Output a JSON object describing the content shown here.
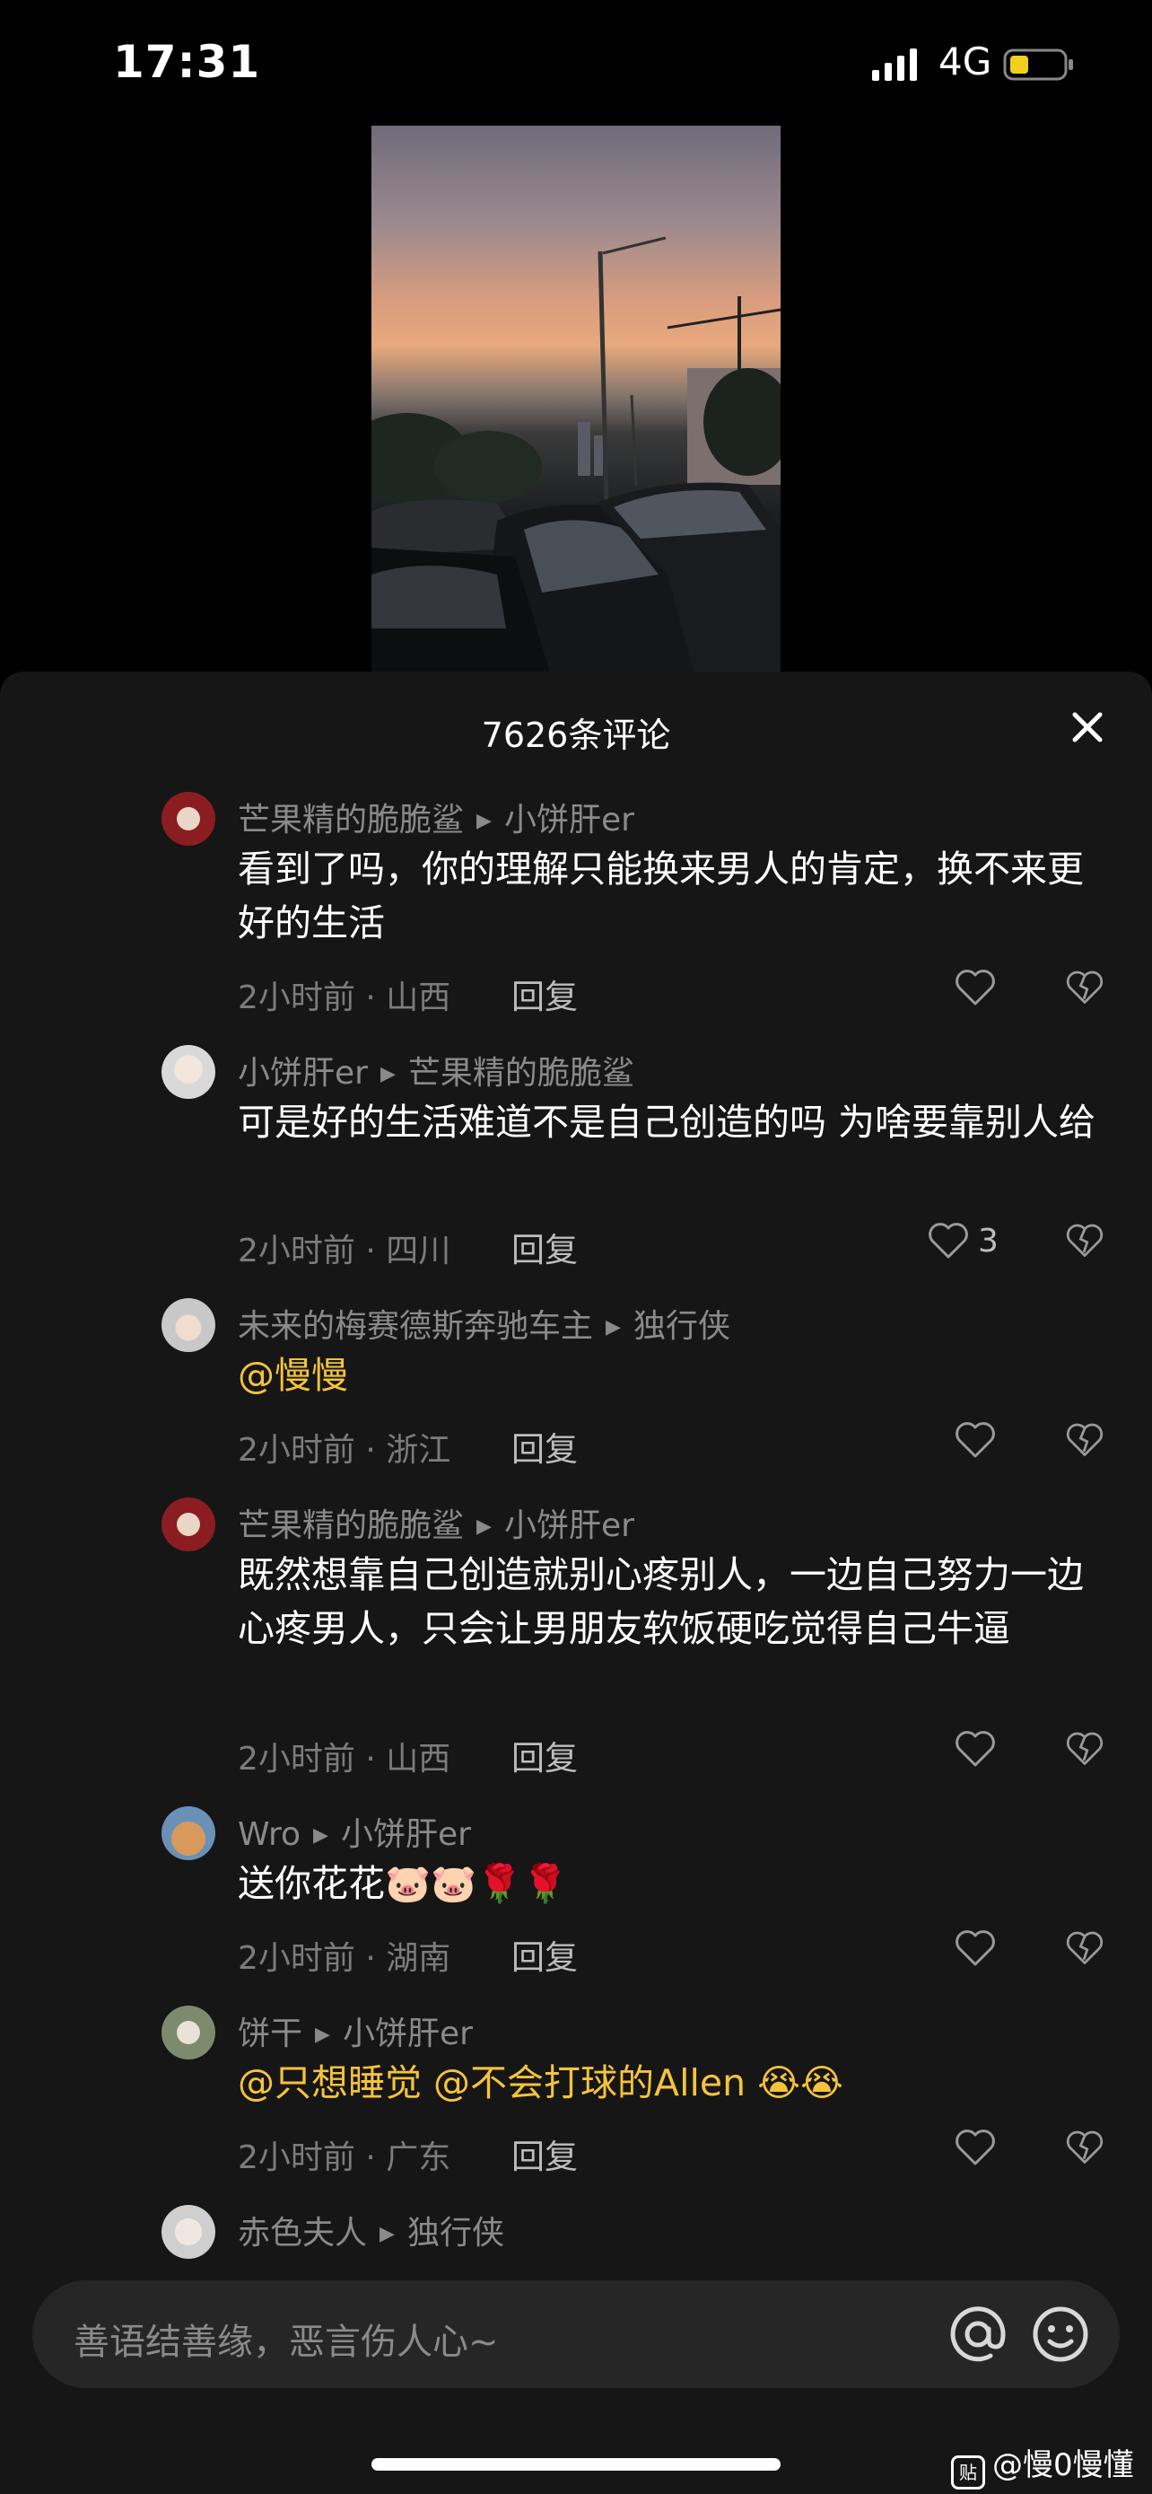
{
  "status": {
    "time": "17:31",
    "network": "4G"
  },
  "sheet": {
    "title": "7626条评论"
  },
  "comments": [
    {
      "author": "芒果精的脆脆鲨",
      "reply_to": "小饼肝er",
      "text": "看到了吗，你的理解只能换来男人的肯定，换不来更好的生活",
      "meta": "2小时前 · 山西",
      "reply_label": "回复",
      "likes": ""
    },
    {
      "author": "小饼肝er",
      "reply_to": "芒果精的脆脆鲨",
      "text": "可是好的生活难道不是自己创造的吗 为啥要靠别人给",
      "meta": "2小时前 · 四川",
      "reply_label": "回复",
      "likes": "3"
    },
    {
      "author": "未来的梅赛德斯奔驰车主",
      "reply_to": "独行侠",
      "text": "@慢慢",
      "meta": "2小时前 · 浙江",
      "reply_label": "回复",
      "likes": ""
    },
    {
      "author": "芒果精的脆脆鲨",
      "reply_to": "小饼肝er",
      "text": "既然想靠自己创造就别心疼别人，一边自己努力一边心疼男人，只会让男朋友软饭硬吃觉得自己牛逼",
      "meta": "2小时前 · 山西",
      "reply_label": "回复",
      "likes": ""
    },
    {
      "author": "Wro",
      "reply_to": "小饼肝er",
      "text": "送你花花🐷🐷🌹🌹",
      "meta": "2小时前 · 湖南",
      "reply_label": "回复",
      "likes": ""
    },
    {
      "author": "饼干",
      "reply_to": "小饼肝er",
      "text": "@只想睡觉 @不会打球的Allen 😭😭",
      "meta": "2小时前 · 广东",
      "reply_label": "回复",
      "likes": ""
    },
    {
      "author": "赤色夫人",
      "reply_to": "独行侠"
    }
  ],
  "input": {
    "placeholder": "善语结善缘，恶言伤人心~"
  },
  "watermark": {
    "logo_text": "贴",
    "text": "@慢0慢懂"
  },
  "colors": {
    "mention": "#f5c33b",
    "sheet_bg": "#161616"
  },
  "icons": [
    "signal-icon",
    "battery-icon",
    "close-icon",
    "heart-icon",
    "broken-heart-icon",
    "at-icon",
    "emoji-icon"
  ]
}
